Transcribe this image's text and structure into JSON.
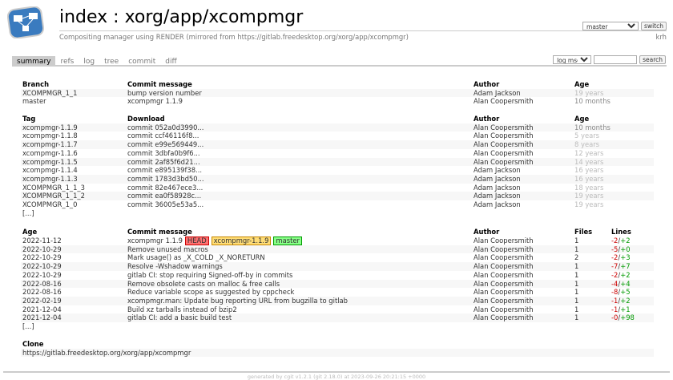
{
  "header": {
    "title": "index : xorg/app/xcompmgr",
    "description": "Compositing manager using RENDER (mirrored from https://gitlab.freedesktop.org/xorg/app/xcompmgr)",
    "owner": "krh",
    "branch_select": "master",
    "switch_label": "switch"
  },
  "tabs": [
    "summary",
    "refs",
    "log",
    "tree",
    "commit",
    "diff"
  ],
  "search": {
    "type": "log msg",
    "placeholder": "",
    "button": "search"
  },
  "branches": {
    "headers": [
      "Branch",
      "Commit message",
      "Author",
      "Age"
    ],
    "rows": [
      [
        "XCOMPMGR_1_1",
        "bump version number",
        "Adam Jackson",
        "19 years"
      ],
      [
        "master",
        "xcompmgr 1.1.9",
        "Alan Coopersmith",
        "10 months"
      ]
    ]
  },
  "tags": {
    "headers": [
      "Tag",
      "Download",
      "Author",
      "Age"
    ],
    "rows": [
      [
        "xcompmgr-1.1.9",
        "commit 052a0d3990...",
        "Alan Coopersmith",
        "10 months"
      ],
      [
        "xcompmgr-1.1.8",
        "commit ccf46116f8...",
        "Alan Coopersmith",
        "5 years"
      ],
      [
        "xcompmgr-1.1.7",
        "commit e99e569449...",
        "Alan Coopersmith",
        "8 years"
      ],
      [
        "xcompmgr-1.1.6",
        "commit 3dbfa0b9f6...",
        "Alan Coopersmith",
        "12 years"
      ],
      [
        "xcompmgr-1.1.5",
        "commit 2af85f6d21...",
        "Alan Coopersmith",
        "14 years"
      ],
      [
        "xcompmgr-1.1.4",
        "commit e895139f38...",
        "Adam Jackson",
        "16 years"
      ],
      [
        "xcompmgr-1.1.3",
        "commit 1783d3bd50...",
        "Adam Jackson",
        "16 years"
      ],
      [
        "XCOMPMGR_1_1_3",
        "commit 82e467ece3...",
        "Adam Jackson",
        "18 years"
      ],
      [
        "XCOMPMGR_1_1_2",
        "commit ea0f58928c...",
        "Adam Jackson",
        "19 years"
      ],
      [
        "XCOMPMGR_1_0",
        "commit 36005e53a5...",
        "Adam Jackson",
        "19 years"
      ]
    ],
    "more": "[...]"
  },
  "log": {
    "headers": [
      "Age",
      "Commit message",
      "Author",
      "Files",
      "Lines"
    ],
    "decorations": [
      "HEAD",
      "xcompmgr-1.1.9",
      "master"
    ],
    "rows": [
      [
        "2022-11-12",
        "xcompmgr 1.1.9",
        "Alan Coopersmith",
        "1",
        "-2",
        "+2"
      ],
      [
        "2022-10-29",
        "Remove unused macros",
        "Alan Coopersmith",
        "1",
        "-5",
        "+0"
      ],
      [
        "2022-10-29",
        "Mark usage() as _X_COLD _X_NORETURN",
        "Alan Coopersmith",
        "2",
        "-2",
        "+3"
      ],
      [
        "2022-10-29",
        "Resolve -Wshadow warnings",
        "Alan Coopersmith",
        "1",
        "-7",
        "+7"
      ],
      [
        "2022-10-29",
        "gitlab CI: stop requiring Signed-off-by in commits",
        "Alan Coopersmith",
        "1",
        "-2",
        "+2"
      ],
      [
        "2022-08-16",
        "Remove obsolete casts on malloc & free calls",
        "Alan Coopersmith",
        "1",
        "-4",
        "+4"
      ],
      [
        "2022-08-16",
        "Reduce variable scope as suggested by cppcheck",
        "Alan Coopersmith",
        "1",
        "-8",
        "+5"
      ],
      [
        "2022-02-19",
        "xcompmgr.man: Update bug reporting URL from bugzilla to gitlab",
        "Alan Coopersmith",
        "1",
        "-1",
        "+2"
      ],
      [
        "2021-12-04",
        "Build xz tarballs instead of bzip2",
        "Alan Coopersmith",
        "1",
        "-1",
        "+1"
      ],
      [
        "2021-12-04",
        "gitlab CI: add a basic build test",
        "Alan Coopersmith",
        "1",
        "-0",
        "+98"
      ]
    ],
    "more": "[...]"
  },
  "clone": {
    "header": "Clone",
    "url": "https://gitlab.freedesktop.org/xorg/app/xcompmgr"
  },
  "footer": "generated by cgit v1.2.1 (git 2.18.0) at 2023-09-26 20:21:15 +0000"
}
